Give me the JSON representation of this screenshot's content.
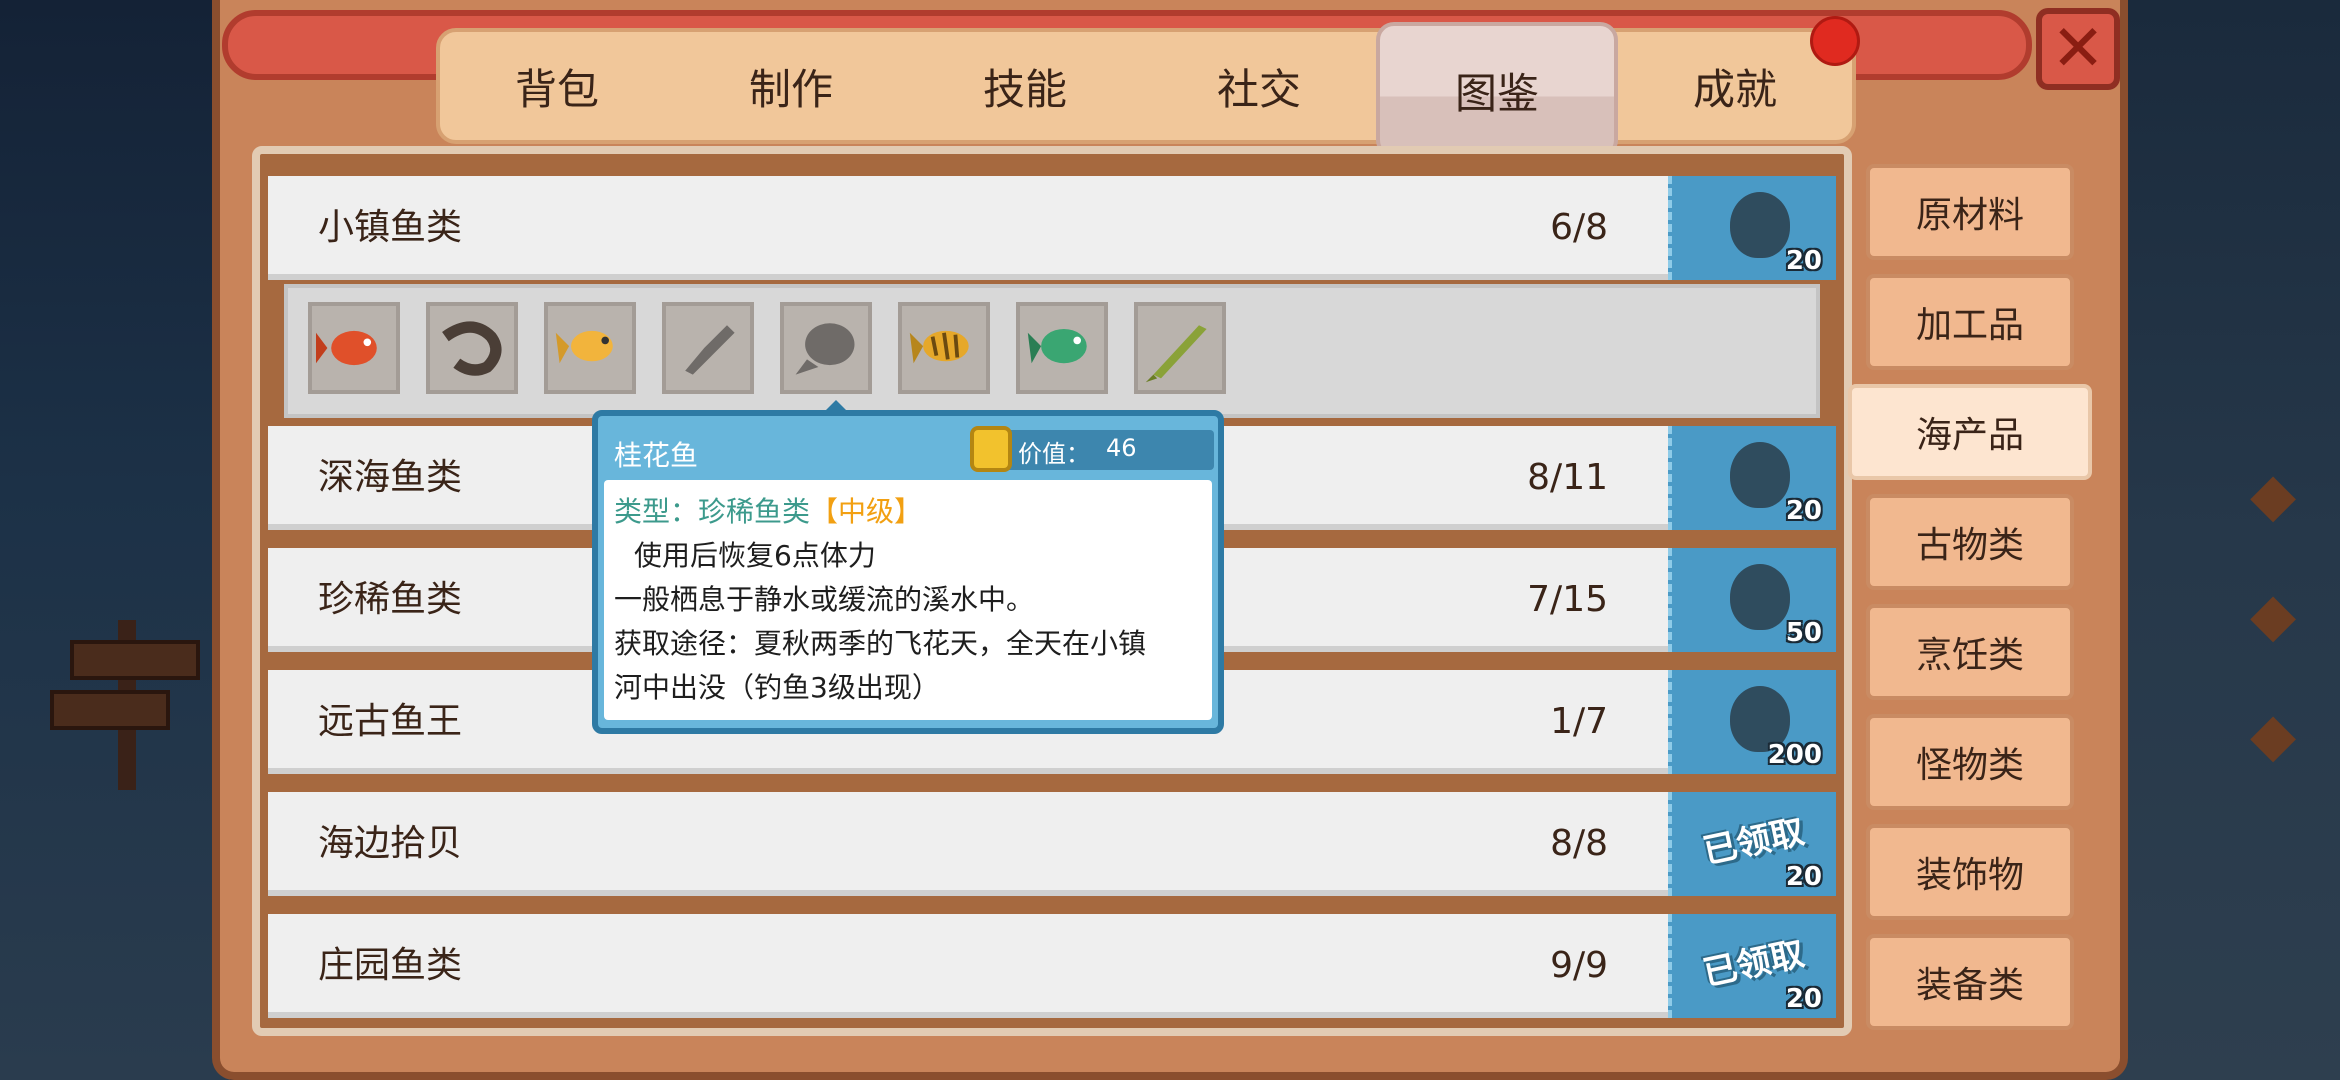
{
  "tabs": [
    {
      "label": "背包"
    },
    {
      "label": "制作"
    },
    {
      "label": "技能"
    },
    {
      "label": "社交"
    },
    {
      "label": "图鉴",
      "active": true
    },
    {
      "label": "成就"
    }
  ],
  "close_button": {
    "icon": "close-icon"
  },
  "categories": [
    {
      "label": "原材料"
    },
    {
      "label": "加工品"
    },
    {
      "label": "海产品",
      "active": true
    },
    {
      "label": "古物类"
    },
    {
      "label": "烹饪类"
    },
    {
      "label": "怪物类"
    },
    {
      "label": "装饰物"
    },
    {
      "label": "装备类"
    }
  ],
  "collections": [
    {
      "name": "小镇鱼类",
      "count": "6/8",
      "reward": "20",
      "claimed_label": ""
    },
    {
      "name": "深海鱼类",
      "count": "8/11",
      "reward": "20",
      "claimed_label": ""
    },
    {
      "name": "珍稀鱼类",
      "count": "7/15",
      "reward": "50",
      "claimed_label": ""
    },
    {
      "name": "远古鱼王",
      "count": "1/7",
      "reward": "200",
      "claimed_label": ""
    },
    {
      "name": "海边拾贝",
      "count": "8/8",
      "reward": "20",
      "claimed_label": "已领取"
    },
    {
      "name": "庄园鱼类",
      "count": "9/9",
      "reward": "20",
      "claimed_label": "已领取"
    }
  ],
  "fish_slots": [
    {
      "icon": "red-fish-icon",
      "color": "#e0502a"
    },
    {
      "icon": "eel-icon",
      "color": "#4a3e36"
    },
    {
      "icon": "yellow-fish-icon",
      "color": "#f2b43c"
    },
    {
      "icon": "unknown-fish-silhouette-icon",
      "color": "#6f6b68"
    },
    {
      "icon": "unknown-fish-silhouette-icon",
      "color": "#6f6b68"
    },
    {
      "icon": "mandarin-fish-icon",
      "color": "#e6a82a"
    },
    {
      "icon": "green-fish-icon",
      "color": "#3aa672"
    },
    {
      "icon": "pike-fish-icon",
      "color": "#8aa238"
    }
  ],
  "tooltip": {
    "name": "桂花鱼",
    "value_label": "价值：",
    "value": "46",
    "type_label": "类型：珍稀鱼类",
    "grade": "【中级】",
    "effect": "使用后恢复6点体力",
    "habitat": "一般栖息于静水或缓流的溪水中。",
    "source_line1": "获取途径：夏秋两季的飞花天，全天在小镇",
    "source_line2": "河中出没（钓鱼3级出现）"
  }
}
